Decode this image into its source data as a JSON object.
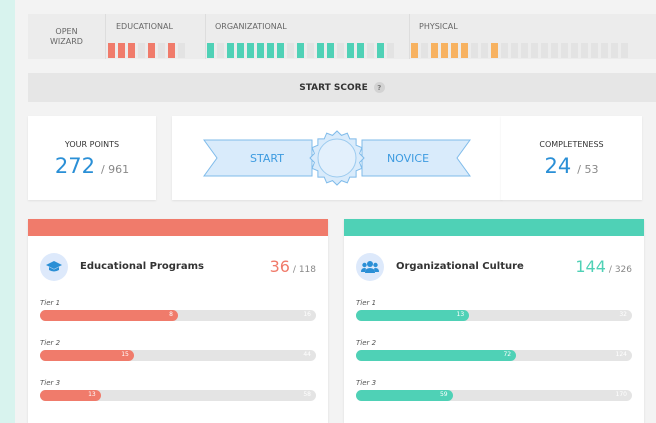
{
  "colors": {
    "educational": "#f07b6b",
    "organizational": "#4fd1b6",
    "physical": "#f7b261",
    "accent": "#2a8fd6"
  },
  "wizard": {
    "open_label": "OPEN\nWIZARD",
    "sections": [
      {
        "label": "EDUCATIONAL",
        "kind": "edu",
        "steps": [
          1,
          1,
          1,
          0,
          1,
          0,
          1,
          0
        ]
      },
      {
        "label": "ORGANIZATIONAL",
        "kind": "org",
        "steps": [
          1,
          0,
          1,
          1,
          1,
          1,
          1,
          1,
          0,
          1,
          0,
          1,
          1,
          0,
          1,
          1,
          0,
          1,
          0
        ]
      },
      {
        "label": "PHYSICAL",
        "kind": "phy",
        "steps": [
          1,
          0,
          1,
          1,
          1,
          1,
          0,
          0,
          1,
          0,
          0,
          0,
          0,
          0,
          0,
          0,
          0,
          0,
          0,
          0,
          0,
          0
        ]
      }
    ]
  },
  "start_score": {
    "label": "START SCORE",
    "help": "?"
  },
  "points": {
    "label": "YOUR POINTS",
    "value": "272",
    "total": "/ 961"
  },
  "completeness": {
    "label": "COMPLETENESS",
    "value": "24",
    "total": "/ 53"
  },
  "ribbon": {
    "left": "START",
    "right": "NOVICE"
  },
  "categories": [
    {
      "title": "Educational Programs",
      "icon": "graduation-cap-icon",
      "color": "#f07b6b",
      "score": "36",
      "total": "/ 118",
      "tiers": [
        {
          "label": "Tier 1",
          "value": "8",
          "max": "16",
          "fraction": 0.5
        },
        {
          "label": "Tier 2",
          "value": "15",
          "max": "44",
          "fraction": 0.34
        },
        {
          "label": "Tier 3",
          "value": "13",
          "max": "58",
          "fraction": 0.22
        }
      ]
    },
    {
      "title": "Organizational Culture",
      "icon": "users-icon",
      "color": "#4fd1b6",
      "score": "144",
      "total": "/ 326",
      "tiers": [
        {
          "label": "Tier 1",
          "value": "13",
          "max": "32",
          "fraction": 0.41
        },
        {
          "label": "Tier 2",
          "value": "72",
          "max": "124",
          "fraction": 0.58
        },
        {
          "label": "Tier 3",
          "value": "59",
          "max": "170",
          "fraction": 0.35
        }
      ]
    }
  ]
}
